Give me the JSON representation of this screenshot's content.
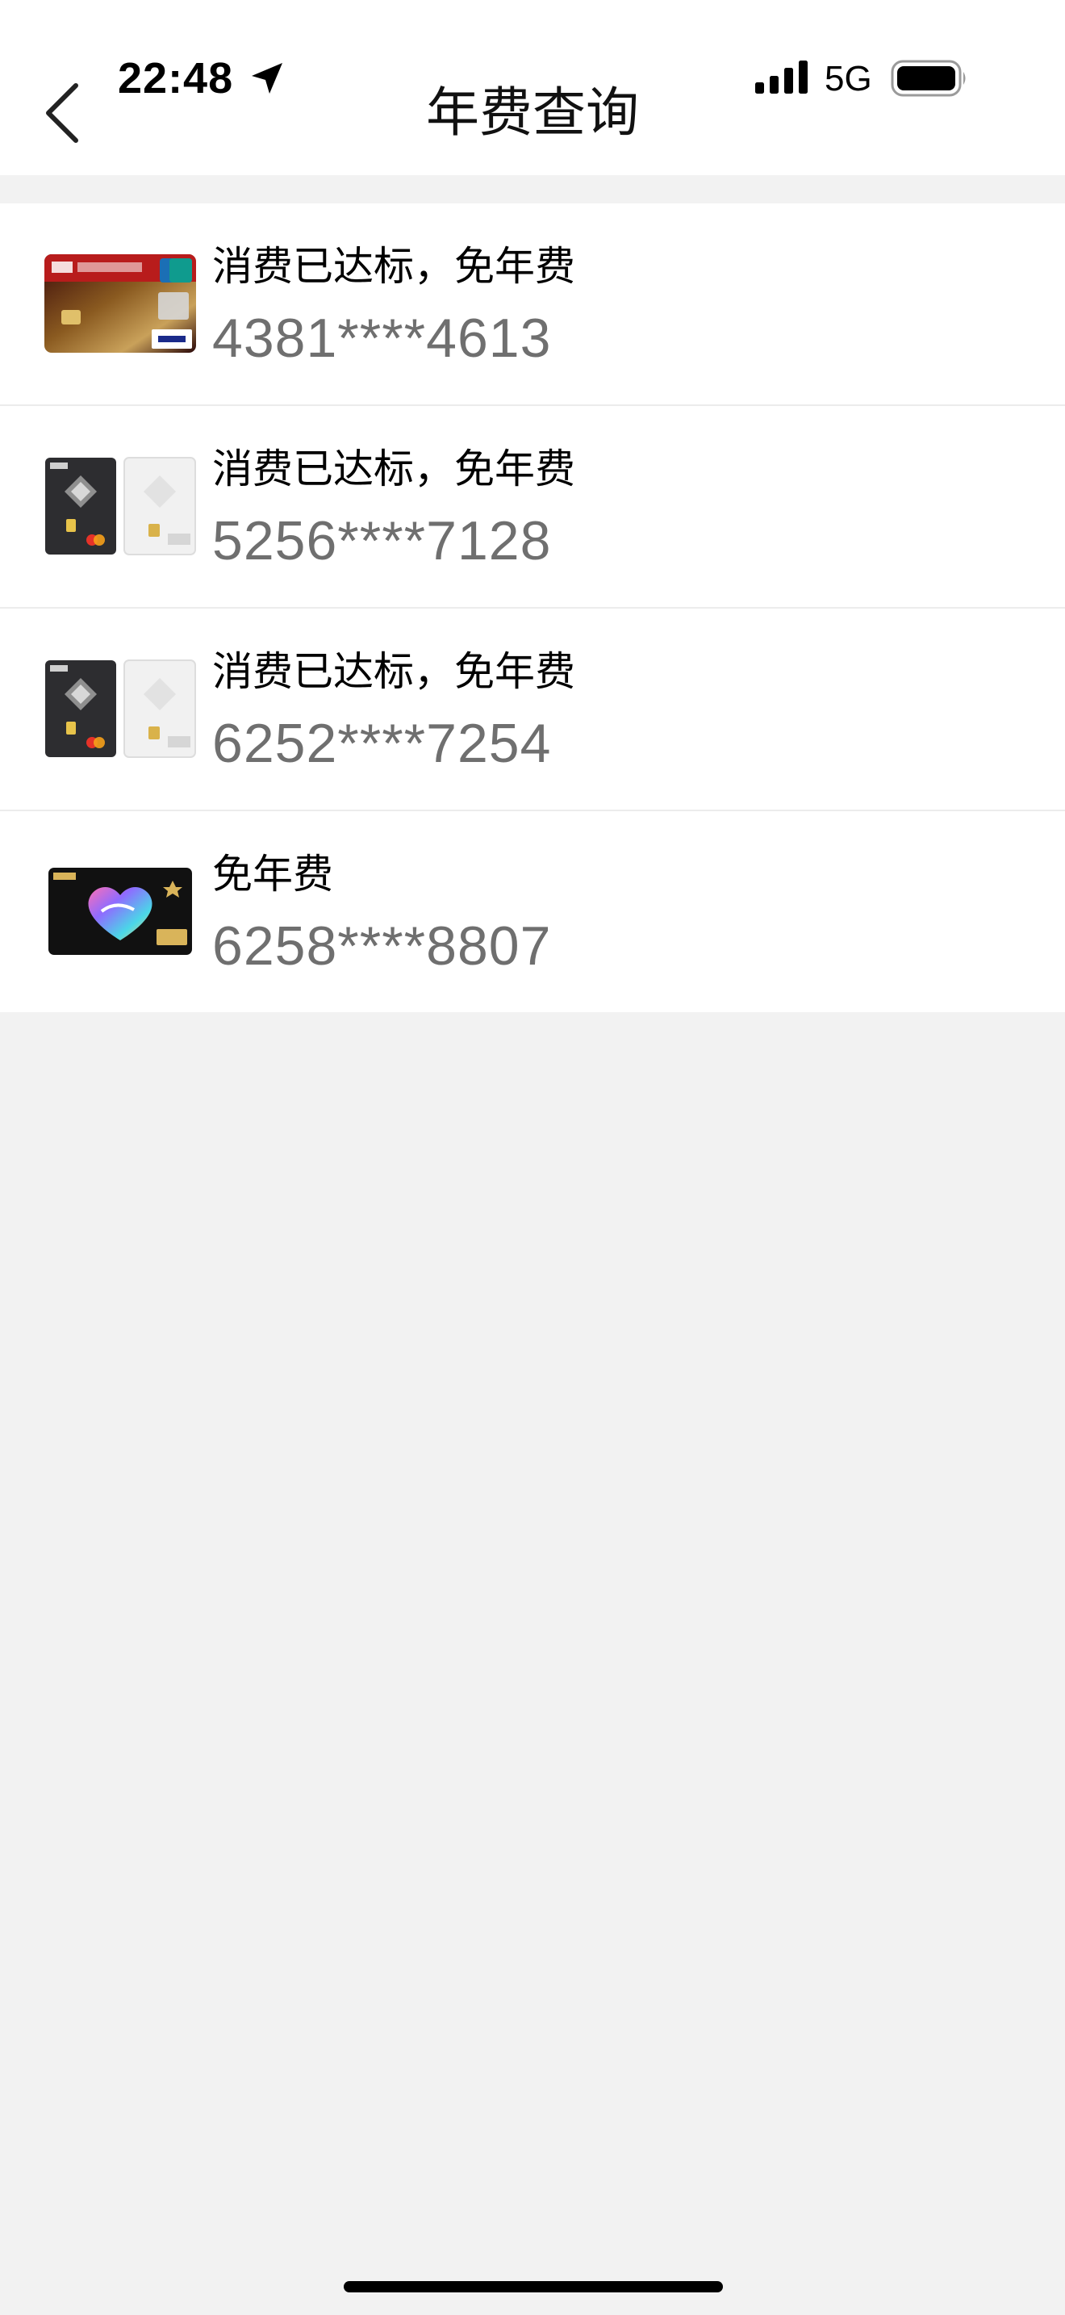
{
  "status_bar": {
    "time": "22:48",
    "network": "5G"
  },
  "header": {
    "title": "年费查询"
  },
  "cards": [
    {
      "status": "消费已达标，免年费",
      "number": "4381****4613",
      "design": "icbc-unionpay-visa-gold"
    },
    {
      "status": "消费已达标，免年费",
      "number": "5256****7128",
      "design": "icbc-dual-black-white"
    },
    {
      "status": "消费已达标，免年费",
      "number": "6252****7254",
      "design": "icbc-dual-black-white"
    },
    {
      "status": "免年费",
      "number": "6258****8807",
      "design": "icbc-black-heart"
    }
  ]
}
